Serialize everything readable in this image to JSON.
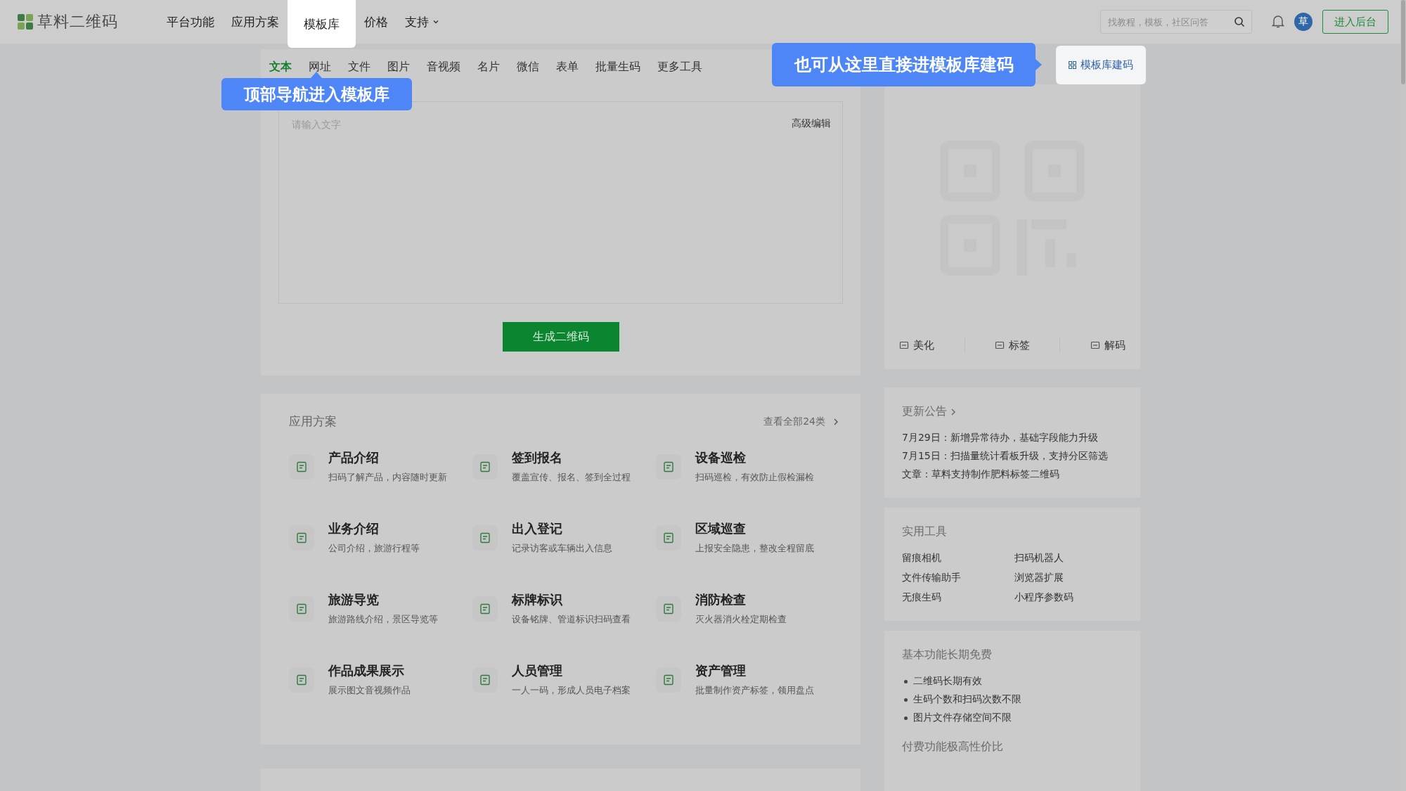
{
  "header": {
    "logo": "草料二维码",
    "nav": [
      {
        "label": "平台功能",
        "highlighted": false,
        "has_caret": false
      },
      {
        "label": "应用方案",
        "highlighted": false,
        "has_caret": false
      },
      {
        "label": "模板库",
        "highlighted": true,
        "has_caret": false
      },
      {
        "label": "价格",
        "highlighted": false,
        "has_caret": false
      },
      {
        "label": "支持",
        "highlighted": false,
        "has_caret": true
      }
    ],
    "search": {
      "placeholder": "找教程，模板，社区问答"
    },
    "avatar": "草",
    "console_button": "进入后台"
  },
  "generator": {
    "tabs": [
      {
        "label": "文本",
        "selected": true
      },
      {
        "label": "网址",
        "selected": false
      },
      {
        "label": "文件",
        "selected": false
      },
      {
        "label": "图片",
        "selected": false
      },
      {
        "label": "音视频",
        "selected": false
      },
      {
        "label": "名片",
        "selected": false
      },
      {
        "label": "微信",
        "selected": false
      },
      {
        "label": "表单",
        "selected": false
      },
      {
        "label": "批量生码",
        "selected": false
      },
      {
        "label": "更多工具",
        "selected": false
      }
    ],
    "textarea": {
      "placeholder": "请输入文字"
    },
    "advanced_edit": "高级编辑",
    "generate_button": "生成二维码"
  },
  "template_button": {
    "label": "模板库建码",
    "highlighted": true
  },
  "preview": {
    "actions": [
      "美化",
      "标签",
      "解码"
    ]
  },
  "callouts": [
    {
      "text": "顶部导航进入模板库",
      "kind": "up"
    },
    {
      "text": "也可从这里直接进模板库建码",
      "kind": "right"
    }
  ],
  "solutions": {
    "title": "应用方案",
    "view_all": "查看全部24类",
    "items": [
      {
        "title": "产品介绍",
        "desc": "扫码了解产品，内容随时更新"
      },
      {
        "title": "签到报名",
        "desc": "覆盖宣传、报名、签到全过程"
      },
      {
        "title": "设备巡检",
        "desc": "扫码巡检，有效防止假检漏检"
      },
      {
        "title": "业务介绍",
        "desc": "公司介绍，旅游行程等"
      },
      {
        "title": "出入登记",
        "desc": "记录访客或车辆出入信息"
      },
      {
        "title": "区域巡查",
        "desc": "上报安全隐患，整改全程留底"
      },
      {
        "title": "旅游导览",
        "desc": "旅游路线介绍，景区导览等"
      },
      {
        "title": "标牌标识",
        "desc": "设备铭牌、管道标识扫码查看"
      },
      {
        "title": "消防检查",
        "desc": "灭火器消火栓定期检查"
      },
      {
        "title": "作品成果展示",
        "desc": "展示图文音视频作品"
      },
      {
        "title": "人员管理",
        "desc": "一人一码，形成人员电子档案"
      },
      {
        "title": "资产管理",
        "desc": "批量制作资产标签，领用盘点"
      }
    ]
  },
  "announcements": {
    "title": "更新公告",
    "items": [
      "7月29日：新增异常待办，基础字段能力升级",
      "7月15日：扫描量统计看板升级，支持分区筛选",
      "文章：草料支持制作肥料标签二维码"
    ]
  },
  "tools": {
    "title": "实用工具",
    "items": [
      "留痕相机",
      "扫码机器人",
      "文件传输助手",
      "浏览器扩展",
      "无痕生码",
      "小程序参数码"
    ]
  },
  "free": {
    "title": "基本功能长期免费",
    "items": [
      "二维码长期有效",
      "生码个数和扫码次数不限",
      "图片文件存储空间不限"
    ],
    "paid_title": "付费功能极高性价比"
  }
}
